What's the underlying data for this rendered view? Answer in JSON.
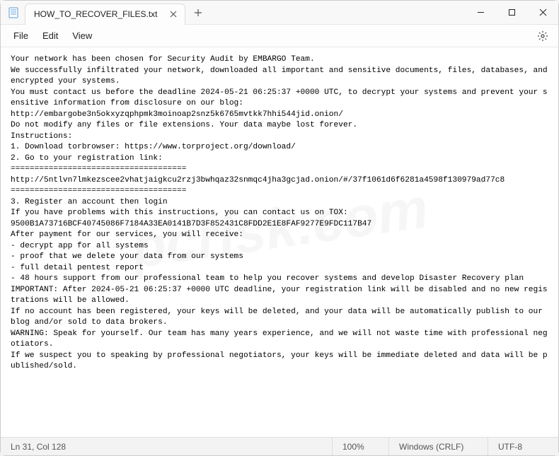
{
  "tab": {
    "title": "HOW_TO_RECOVER_FILES.txt"
  },
  "menu": {
    "file": "File",
    "edit": "Edit",
    "view": "View"
  },
  "body": {
    "l1": "Your network has been chosen for Security Audit by EMBARGO Team.",
    "l2": "",
    "l3": "We successfully infiltrated your network, downloaded all important and sensitive documents, files, databases, and encrypted your systems.",
    "l4": "",
    "l5": "You must contact us before the deadline 2024-05-21 06:25:37 +0000 UTC, to decrypt your systems and prevent your sensitive information from disclosure on our blog:",
    "l6": "http://embargobe3n5okxyzqphpmk3moinoap2snz5k6765mvtkk7hhi544jid.onion/",
    "l7": "",
    "l8": "Do not modify any files or file extensions. Your data maybe lost forever.",
    "l9": "",
    "l10": "Instructions:",
    "l11": "1. Download torbrowser: https://www.torproject.org/download/",
    "l12": "2. Go to your registration link:",
    "l13": "=====================================",
    "l14": "http://5ntlvn7lmkezscee2vhatjaigkcu2rzj3bwhqaz32snmqc4jha3gcjad.onion/#/37f1061d6f6281a4598f130979ad77c8",
    "l15": "=====================================",
    "l16": "3. Register an account then login",
    "l17": "",
    "l18": "If you have problems with this instructions, you can contact us on TOX:",
    "l19": "9500B1A73716BCF40745086F7184A33EA0141B7D3F852431C8FDD2E1E8FAF9277E9FDC117B47",
    "l20": "",
    "l21": "After payment for our services, you will receive:",
    "l22": "- decrypt app for all systems",
    "l23": "- proof that we delete your data from our systems",
    "l24": "- full detail pentest report",
    "l25": "- 48 hours support from our professional team to help you recover systems and develop Disaster Recovery plan",
    "l26": "",
    "l27": "IMPORTANT: After 2024-05-21 06:25:37 +0000 UTC deadline, your registration link will be disabled and no new registrations will be allowed.",
    "l28": "If no account has been registered, your keys will be deleted, and your data will be automatically publish to our blog and/or sold to data brokers.",
    "l29": "",
    "l30": "WARNING: Speak for yourself. Our team has many years experience, and we will not waste time with professional negotiators.",
    "l31": "If we suspect you to speaking by professional negotiators, your keys will be immediate deleted and data will be published/sold."
  },
  "status": {
    "pos": "Ln 31, Col 128",
    "zoom": "100%",
    "eol": "Windows (CRLF)",
    "enc": "UTF-8"
  },
  "watermark": "pcrisk.com"
}
